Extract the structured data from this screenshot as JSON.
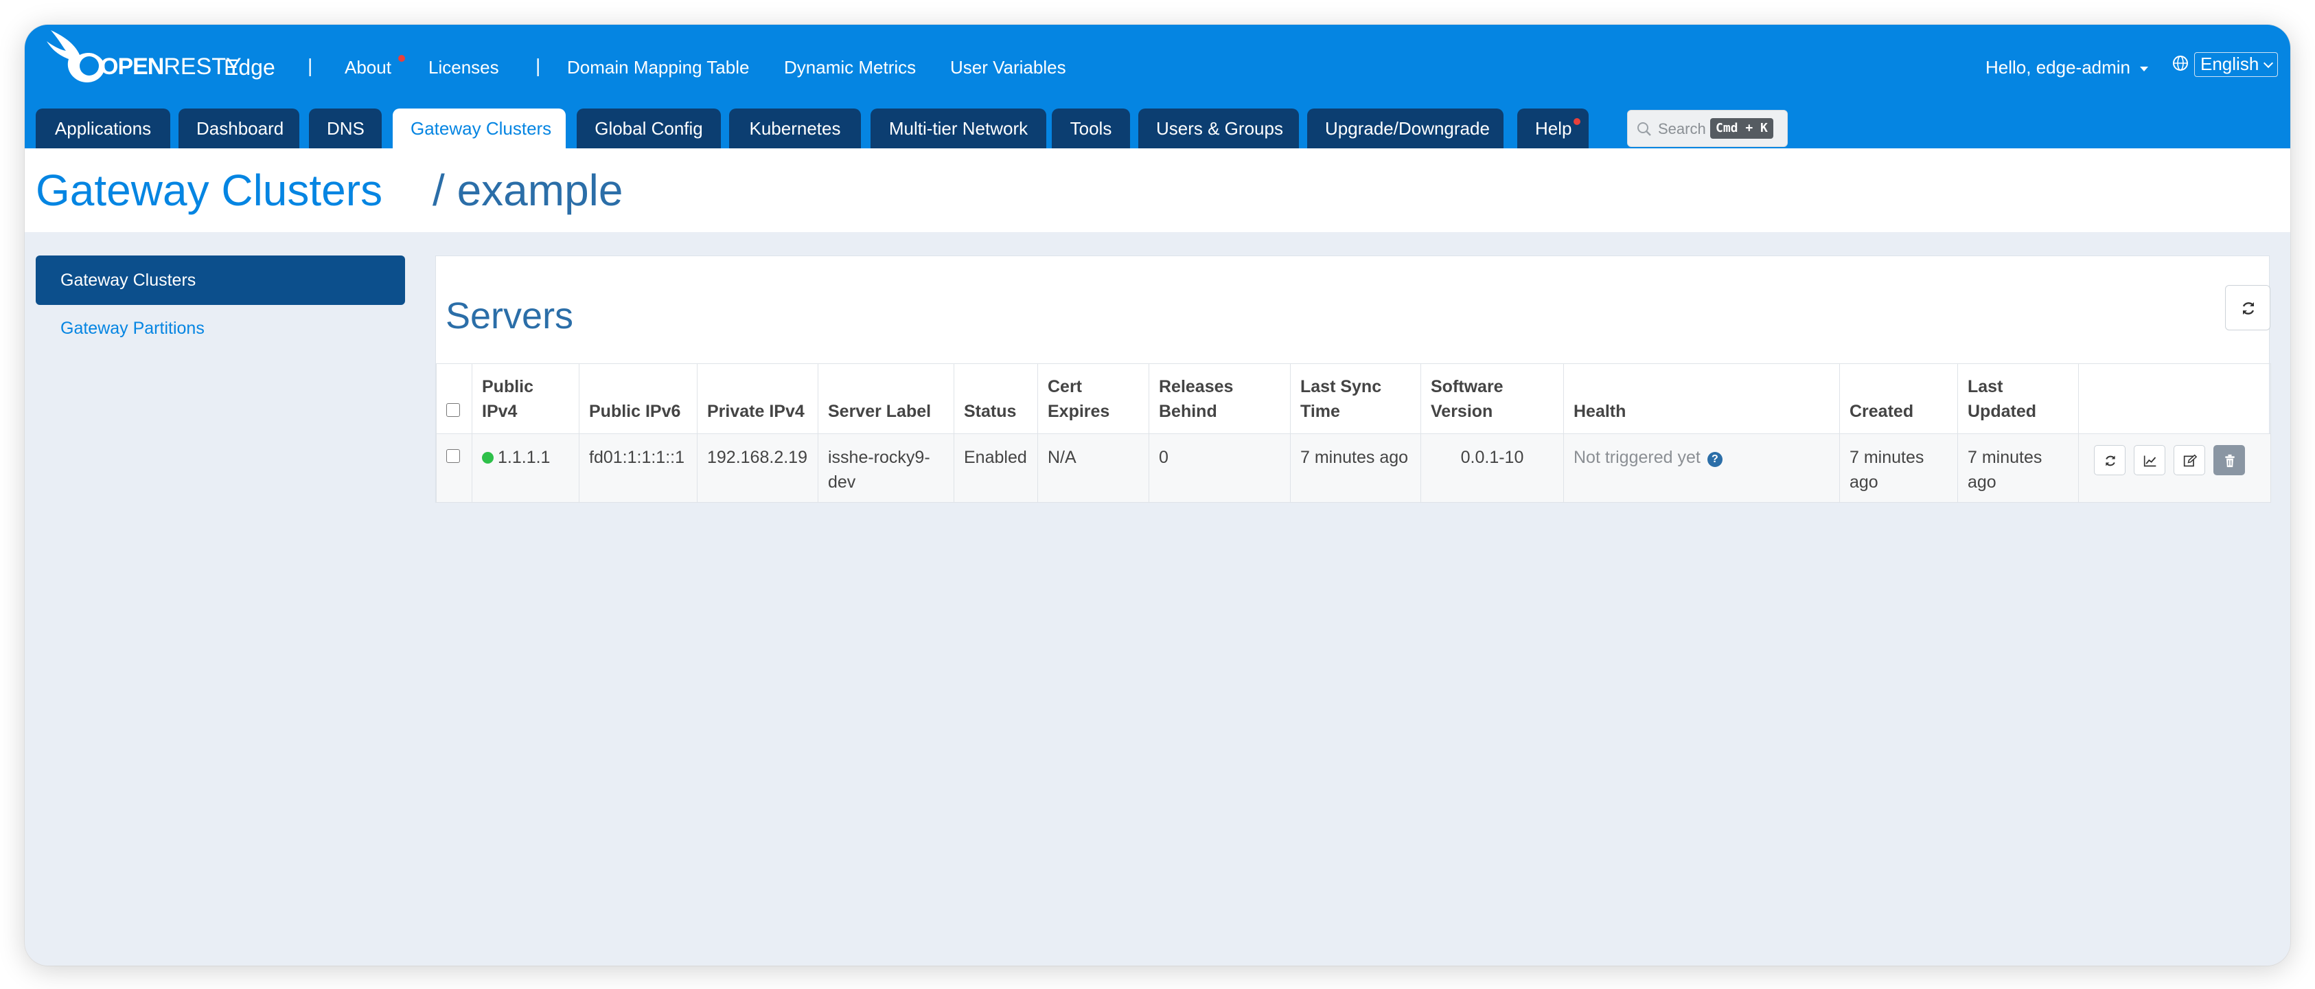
{
  "brand": {
    "logo_text_bold": "OPEN",
    "logo_text_thin": "RESTY",
    "product": "Edge"
  },
  "topnav": {
    "separator": "|",
    "about": "About",
    "licenses": "Licenses",
    "domain_mapping": "Domain Mapping Table",
    "dynamic_metrics": "Dynamic Metrics",
    "user_variables": "User Variables",
    "user_greeting": "Hello, edge-admin",
    "language": "English"
  },
  "tabs": [
    {
      "label": "Applications"
    },
    {
      "label": "Dashboard"
    },
    {
      "label": "DNS"
    },
    {
      "label": "Gateway Clusters"
    },
    {
      "label": "Global Config"
    },
    {
      "label": "Kubernetes"
    },
    {
      "label": "Multi-tier Network"
    },
    {
      "label": "Tools"
    },
    {
      "label": "Users & Groups"
    },
    {
      "label": "Upgrade/Downgrade"
    },
    {
      "label": "Help"
    }
  ],
  "search": {
    "placeholder": "Search",
    "shortcut": "Cmd + K"
  },
  "header": {
    "title": "Gateway Clusters",
    "subtitle": "/ example"
  },
  "sidebar": {
    "items": [
      {
        "label": "Gateway Clusters"
      },
      {
        "label": "Gateway Partitions"
      }
    ]
  },
  "panel": {
    "title": "Servers"
  },
  "table": {
    "headers": {
      "public_ipv4": "Public IPv4",
      "public_ipv6": "Public IPv6",
      "private_ipv4": "Private IPv4",
      "server_label": "Server Label",
      "status": "Status",
      "cert_expires": "Cert Expires",
      "releases_behind": "Releases Behind",
      "last_sync_time": "Last Sync Time",
      "software_version": "Software Version",
      "health": "Health",
      "created": "Created",
      "last_updated": "Last Updated"
    },
    "rows": [
      {
        "public_ipv4": "1.1.1.1",
        "public_ipv6": "fd01:1:1:1::1",
        "private_ipv4": "192.168.2.19",
        "server_label": "isshe-rocky9-dev",
        "status": "Enabled",
        "cert_expires": "N/A",
        "releases_behind": "0",
        "last_sync_time": "7 minutes ago",
        "software_version": "0.0.1-10",
        "health": "Not triggered yet",
        "created": "7 minutes ago",
        "last_updated": "7 minutes ago"
      }
    ]
  },
  "colors": {
    "brand_blue": "#0585e2",
    "tab_dark": "#0c3e71",
    "online_green": "#2ec04a",
    "notification_red": "#e8403a"
  }
}
